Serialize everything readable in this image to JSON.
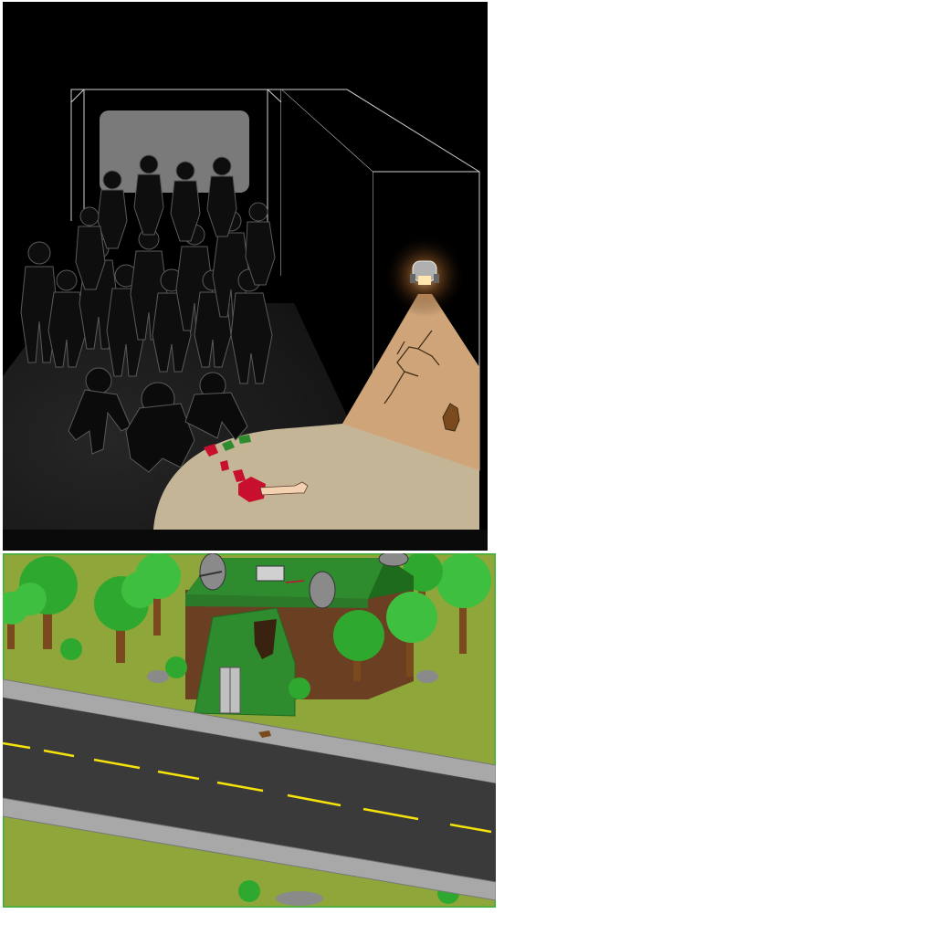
{
  "scenes": [
    {
      "name": "zombie-horde-room",
      "description_icons": [
        "zombie-silhouette",
        "security-camera",
        "severed-arm",
        "cracked-wall"
      ],
      "colors": {
        "background": "#000000",
        "floor_light": "#c5b597",
        "wall_lit": "#cfa478",
        "blood": "#c8102e",
        "doorway": "#7a7a7a"
      }
    },
    {
      "name": "bunker-roadside",
      "description_icons": [
        "bunker",
        "satellite-dish",
        "tree",
        "road"
      ],
      "colors": {
        "grass": "#8fa63a",
        "road": "#3a3a3a",
        "bunker_roof": "#2e8b2e",
        "bunker_wall": "#6b3f22",
        "road_line": "#f5e20b"
      }
    }
  ]
}
